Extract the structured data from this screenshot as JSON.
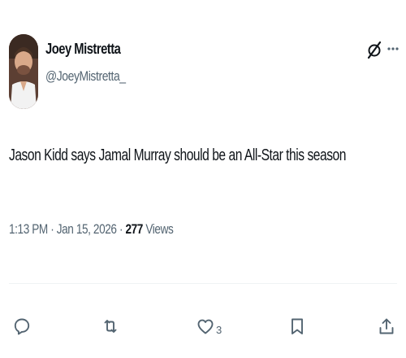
{
  "author": {
    "name": "Joey Mistretta",
    "handle": "@JoeyMistretta_"
  },
  "tweet": {
    "text": "Jason Kidd says Jamal Murray should be an All-Star this season"
  },
  "meta": {
    "time": "1:13 PM",
    "separator": " · ",
    "date": "Jan 15, 2026",
    "views_count": "277",
    "views_label": " Views"
  },
  "actions": {
    "likes_count": "3"
  },
  "icons": {
    "grok": "grok-icon",
    "more": "more-icon",
    "reply": "reply-icon",
    "retweet": "retweet-icon",
    "like": "heart-icon",
    "bookmark": "bookmark-icon",
    "share": "share-icon"
  },
  "colors": {
    "text": "#0f1419",
    "secondary": "#536471",
    "divider": "#eff3f4"
  }
}
